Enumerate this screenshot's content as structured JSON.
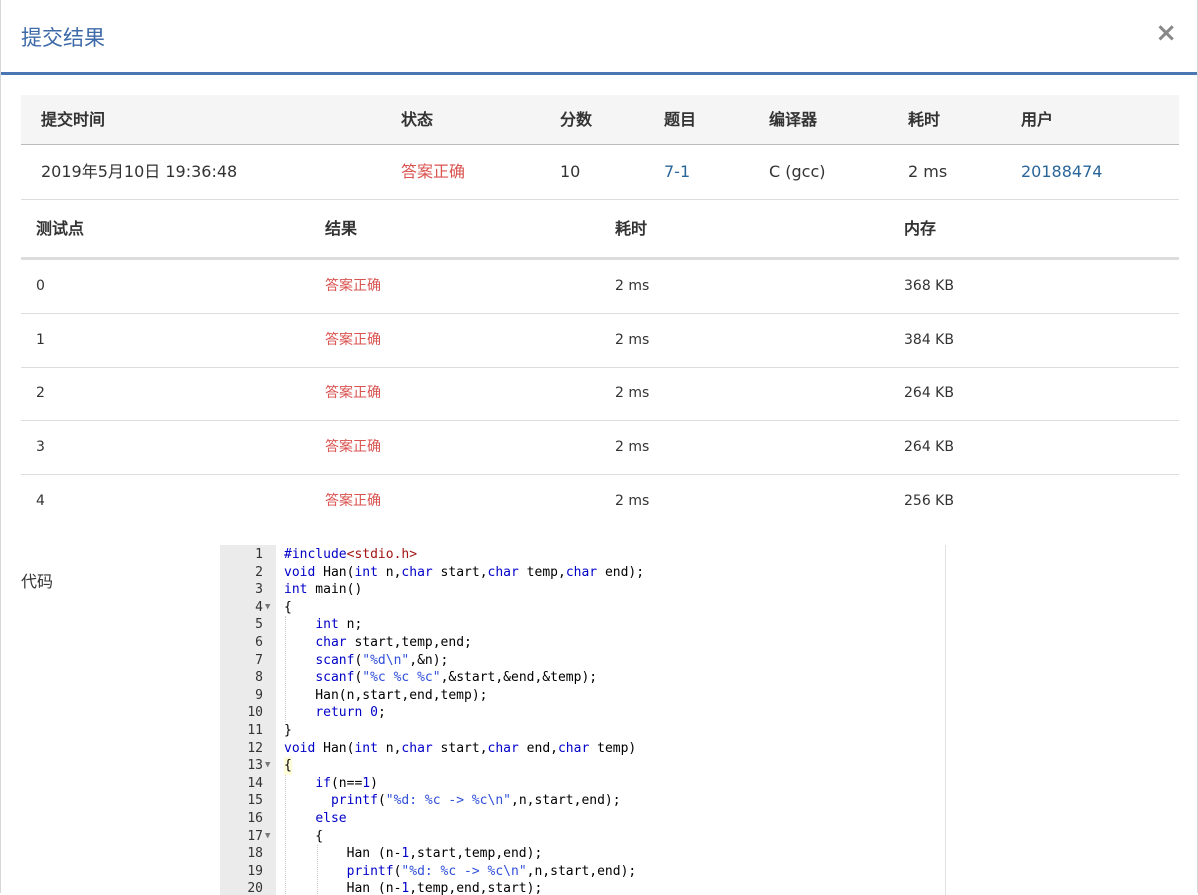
{
  "dialog": {
    "title": "提交结果",
    "close_label": "×"
  },
  "summary": {
    "headers": {
      "time": "提交时间",
      "status": "状态",
      "score": "分数",
      "problem": "题目",
      "compiler": "编译器",
      "elapsed": "耗时",
      "user": "用户"
    },
    "row": {
      "time": "2019年5月10日 19:36:48",
      "status": "答案正确",
      "score": "10",
      "problem": "7-1",
      "compiler": "C (gcc)",
      "elapsed": "2 ms",
      "user": "20188474"
    }
  },
  "tests": {
    "headers": {
      "case": "测试点",
      "result": "结果",
      "elapsed": "耗时",
      "memory": "内存"
    },
    "rows": [
      {
        "case": "0",
        "result": "答案正确",
        "elapsed": "2 ms",
        "memory": "368 KB"
      },
      {
        "case": "1",
        "result": "答案正确",
        "elapsed": "2 ms",
        "memory": "384 KB"
      },
      {
        "case": "2",
        "result": "答案正确",
        "elapsed": "2 ms",
        "memory": "264 KB"
      },
      {
        "case": "3",
        "result": "答案正确",
        "elapsed": "2 ms",
        "memory": "264 KB"
      },
      {
        "case": "4",
        "result": "答案正确",
        "elapsed": "2 ms",
        "memory": "256 KB"
      }
    ]
  },
  "code": {
    "label": "代码",
    "lines": [
      "#include<stdio.h>",
      "void Han(int n,char start,char temp,char end);",
      "int main()",
      "{",
      "    int n;",
      "    char start,temp,end;",
      "    scanf(\"%d\\n\",&n);",
      "    scanf(\"%c %c %c\",&start,&end,&temp);",
      "    Han(n,start,end,temp);",
      "    return 0;",
      "}",
      "void Han(int n,char start,char end,char temp)",
      "{",
      "    if(n==1)",
      "      printf(\"%d: %c -> %c\\n\",n,start,end);",
      "    else",
      "    {",
      "        Han (n-1,start,temp,end);",
      "        printf(\"%d: %c -> %c\\n\",n,start,end);",
      "        Han (n-1,temp,end,start);"
    ],
    "fold_lines": [
      4,
      13,
      17
    ]
  }
}
